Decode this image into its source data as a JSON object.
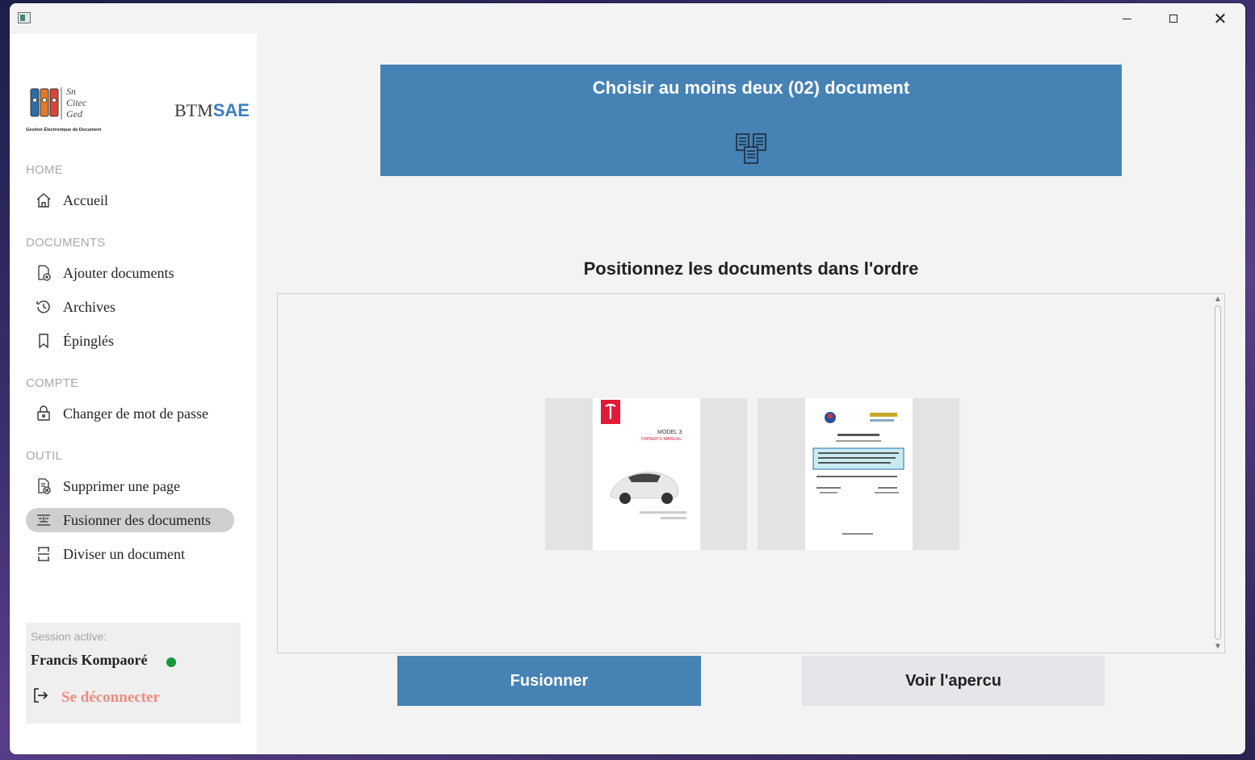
{
  "window": {
    "controls": {
      "minimize": "minimize",
      "maximize": "maximize",
      "close": "close"
    }
  },
  "sidebar": {
    "logo": {
      "line1": "Sn",
      "line2": "Citec",
      "line3": "Ged",
      "caption": "Gestion Électronique de Document"
    },
    "brand": {
      "prefix": "BTM",
      "accent": "SAE"
    },
    "sections": [
      {
        "label": "HOME",
        "items": [
          {
            "label": "Accueil",
            "icon": "home-icon"
          }
        ]
      },
      {
        "label": "DOCUMENTS",
        "items": [
          {
            "label": "Ajouter documents",
            "icon": "add-document-icon"
          },
          {
            "label": "Archives",
            "icon": "history-icon"
          },
          {
            "label": "Épinglés",
            "icon": "bookmark-icon"
          }
        ]
      },
      {
        "label": "COMPTE",
        "items": [
          {
            "label": "Changer de mot de passe",
            "icon": "lock-icon"
          }
        ]
      },
      {
        "label": "OUTIL",
        "items": [
          {
            "label": "Supprimer une page",
            "icon": "delete-page-icon"
          },
          {
            "label": "Fusionner des documents",
            "icon": "merge-icon",
            "active": true
          },
          {
            "label": "Diviser un document",
            "icon": "split-icon"
          }
        ]
      }
    ],
    "session": {
      "title": "Session active:",
      "user": "Francis Kompaoré",
      "status_color": "#129a3a",
      "logout_label": "Se déconnecter",
      "logout_color": "#ef8b7e"
    }
  },
  "main": {
    "banner": {
      "title": "Choisir au moins deux (02) document",
      "icon": "documents-merge-icon",
      "color": "#4682b4"
    },
    "subtitle": "Positionnez les documents dans l'ordre",
    "documents": [
      {
        "name": "tesla-model3-manual",
        "title": "MODEL 3",
        "subtitle": "OWNER'S MANUAL"
      },
      {
        "name": "school-document",
        "title": ""
      }
    ],
    "buttons": {
      "merge": "Fusionner",
      "preview": "Voir l'apercu"
    }
  }
}
